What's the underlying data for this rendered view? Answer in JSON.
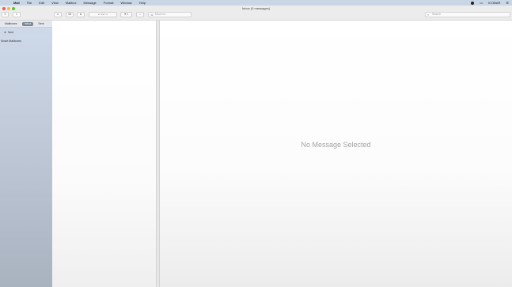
{
  "menubar": {
    "apple": "",
    "items": [
      "Mail",
      "File",
      "Edit",
      "View",
      "Mailbox",
      "Message",
      "Format",
      "Window",
      "Help"
    ],
    "clock": "ICOBAR",
    "status_icons": [
      "record-icon",
      "battery-icon",
      "control-icon"
    ]
  },
  "window": {
    "title": "Inbox (0 messages)"
  },
  "toolbar": {
    "get_mail": "✉",
    "compose": "✎",
    "archive": "⊡",
    "delete": "⌫",
    "junk": "⊠",
    "reply_group": "↩ ↩↩ ↪",
    "flag": "⚑ ▾",
    "mute": "♪",
    "move_placeholder": "Move to...",
    "search_placeholder": "Search"
  },
  "sidebar": {
    "tabs": [
      "Mailboxes",
      "Inbox",
      "Sent"
    ],
    "active_tab": 1,
    "items": [
      {
        "label": "Sent"
      },
      {
        "label": "Smart Mailboxes"
      }
    ]
  },
  "viewer": {
    "empty_text": "No Message Selected"
  }
}
